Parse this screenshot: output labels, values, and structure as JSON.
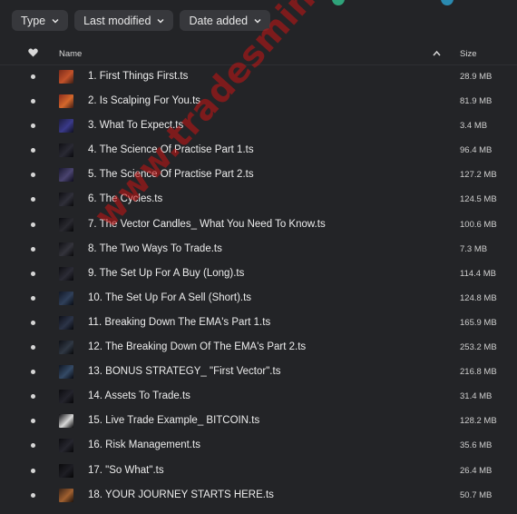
{
  "filters": [
    {
      "label": "Type"
    },
    {
      "label": "Last modified"
    },
    {
      "label": "Date added"
    }
  ],
  "table": {
    "name_header": "Name",
    "size_header": "Size",
    "sort_direction": "ascending"
  },
  "files": [
    {
      "name": "1. First Things First.ts",
      "size": "28.9 MB",
      "thumb": [
        "#7a2a1a",
        "#c2522a",
        "#3a1c14"
      ]
    },
    {
      "name": "2. Is Scalping For You.ts",
      "size": "81.9 MB",
      "thumb": [
        "#8a2c1c",
        "#d4682c",
        "#401c14"
      ]
    },
    {
      "name": "3. What To Expect.ts",
      "size": "3.4 MB",
      "thumb": [
        "#1c1c3c",
        "#3a3a8a",
        "#101020"
      ]
    },
    {
      "name": "4. The Science Of Practise Part 1.ts",
      "size": "96.4 MB",
      "thumb": [
        "#101014",
        "#2a2a34",
        "#08080c"
      ]
    },
    {
      "name": "5. The Science Of Practise Part 2.ts",
      "size": "127.2 MB",
      "thumb": [
        "#1a1830",
        "#4a4470",
        "#0e0c1c"
      ]
    },
    {
      "name": "6. The Cycles.ts",
      "size": "124.5 MB",
      "thumb": [
        "#0e0e12",
        "#30303a",
        "#08080a"
      ]
    },
    {
      "name": "7. The Vector Candles_ What You Need To Know.ts",
      "size": "100.6 MB",
      "thumb": [
        "#0c0c10",
        "#2a2a30",
        "#060608"
      ]
    },
    {
      "name": "8. The Two Ways To Trade.ts",
      "size": "7.3 MB",
      "thumb": [
        "#101014",
        "#34343c",
        "#08080a"
      ]
    },
    {
      "name": "9. The Set Up For A Buy (Long).ts",
      "size": "114.4 MB",
      "thumb": [
        "#0e0e12",
        "#2c2c36",
        "#07070a"
      ]
    },
    {
      "name": "10. The Set Up For A Sell (Short).ts",
      "size": "124.8 MB",
      "thumb": [
        "#121826",
        "#30405a",
        "#080c14"
      ]
    },
    {
      "name": "11. Breaking Down The EMA's Part 1.ts",
      "size": "165.9 MB",
      "thumb": [
        "#0e1018",
        "#2c3448",
        "#07080c"
      ]
    },
    {
      "name": "12. The Breaking Down Of The EMA's Part 2.ts",
      "size": "253.2 MB",
      "thumb": [
        "#0e1016",
        "#303844",
        "#07080a"
      ]
    },
    {
      "name": "13. BONUS STRATEGY_ \"First Vector\".ts",
      "size": "216.8 MB",
      "thumb": [
        "#101622",
        "#344a66",
        "#080a12"
      ]
    },
    {
      "name": "14. Assets To Trade.ts",
      "size": "31.4 MB",
      "thumb": [
        "#0c0c10",
        "#24242c",
        "#060608"
      ]
    },
    {
      "name": "15. Live Trade Example_ BITCOIN.ts",
      "size": "128.2 MB",
      "thumb": [
        "#0c0c10",
        "#d8d8d8",
        "#060608"
      ]
    },
    {
      "name": "16. Risk Management.ts",
      "size": "35.6 MB",
      "thumb": [
        "#0c0c10",
        "#26262e",
        "#060608"
      ]
    },
    {
      "name": "17. \"So What\".ts",
      "size": "26.4 MB",
      "thumb": [
        "#0a0a0c",
        "#1e1e24",
        "#050506"
      ]
    },
    {
      "name": "18. YOUR JOURNEY STARTS HERE.ts",
      "size": "50.7 MB",
      "thumb": [
        "#3a2418",
        "#a06030",
        "#1c100a"
      ]
    }
  ],
  "watermark": "www.tradesmint.com",
  "colors": {
    "background": "#232427",
    "chip": "#37383c",
    "watermark": "#c81414",
    "top_accent_green": "#2fa37a",
    "top_accent_teal": "#2a8ab0"
  },
  "icons": {
    "favorites_header": "heart-icon",
    "sort": "chevron-up-icon",
    "filter_dropdown": "chevron-down-icon"
  }
}
